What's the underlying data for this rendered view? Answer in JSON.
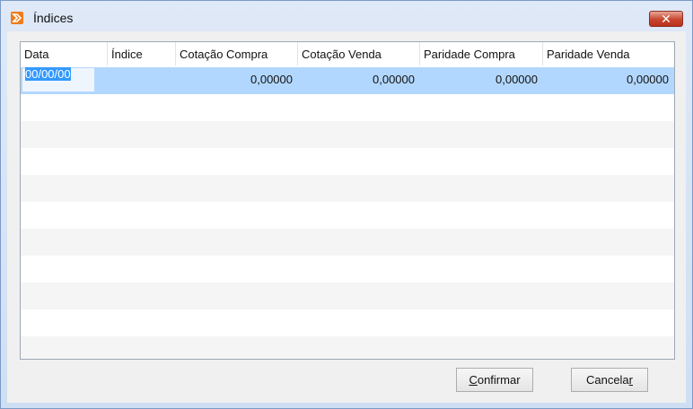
{
  "window": {
    "title": "Índices",
    "close_symbol": "✕",
    "accent": "#f07c1a"
  },
  "grid": {
    "columns": [
      "Data",
      "Índice",
      "Cotação Compra",
      "Cotação Venda",
      "Paridade Compra",
      "Paridade Venda"
    ],
    "rows": [
      {
        "data": "00/00/00",
        "indice": "",
        "cotacao_compra": "0,00000",
        "cotacao_venda": "0,00000",
        "paridade_compra": "0,00000",
        "paridade_venda": "0,00000"
      }
    ]
  },
  "buttons": {
    "confirm": {
      "pre": "",
      "key": "C",
      "post": "onfirmar"
    },
    "cancel": {
      "pre": "Cancela",
      "key": "r",
      "post": ""
    }
  }
}
